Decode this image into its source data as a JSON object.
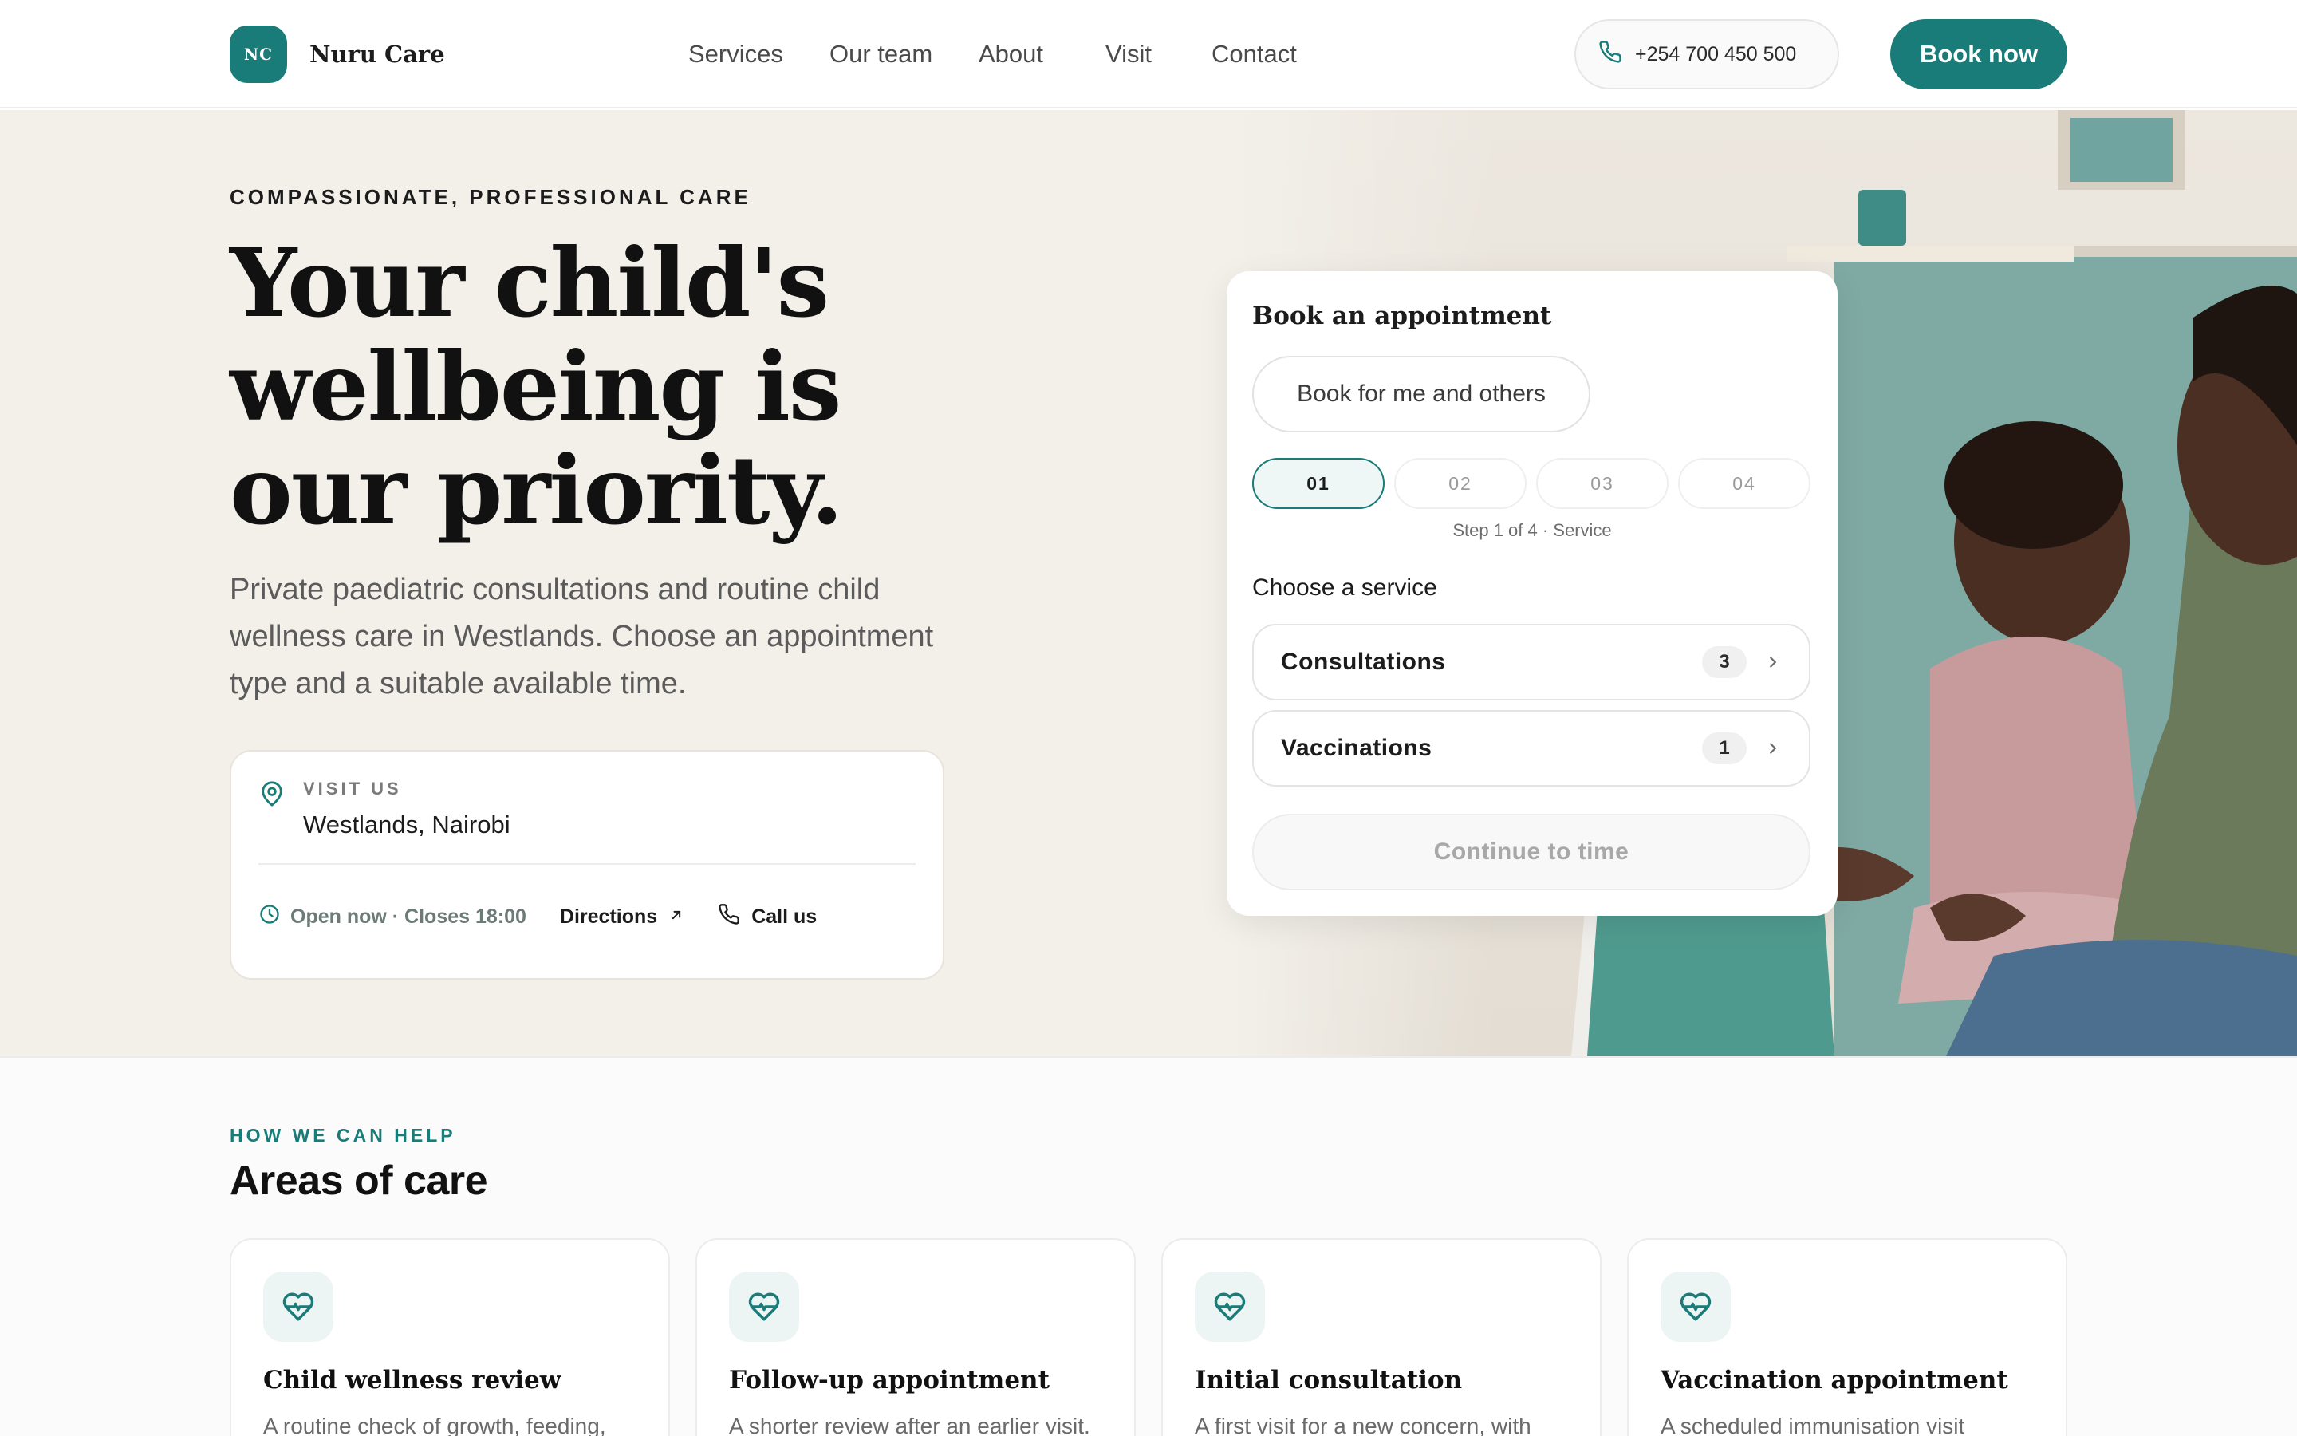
{
  "brand": {
    "monogram": "NC",
    "name": "Nuru Care"
  },
  "nav": {
    "items": [
      "Services",
      "Our team",
      "About",
      "Visit",
      "Contact"
    ],
    "phone": "+254 700 450 500",
    "book_label": "Book now"
  },
  "hero": {
    "eyebrow": "COMPASSIONATE, PROFESSIONAL CARE",
    "headline_lines": [
      "Your child's",
      "wellbeing is",
      "our priority."
    ],
    "lead": "Private paediatric consultations and routine child wellness care in Westlands. Choose an appointment type and a suitable available time.",
    "visit": {
      "label": "VISIT US",
      "location": "Westlands, Nairobi",
      "status": "Open now · Closes 18:00",
      "directions": "Directions",
      "call": "Call us"
    }
  },
  "booking": {
    "title": "Book an appointment",
    "for_option": "Book for me and others",
    "steps": [
      "01",
      "02",
      "03",
      "04"
    ],
    "active_step": 0,
    "step_caption": "Step 1 of 4 · Service",
    "choose_label": "Choose a service",
    "services": [
      {
        "name": "Consultations",
        "count": "3"
      },
      {
        "name": "Vaccinations",
        "count": "1"
      }
    ],
    "continue_label": "Continue to time"
  },
  "areas": {
    "eyebrow": "HOW WE CAN HELP",
    "title": "Areas of care",
    "cards": [
      {
        "icon": "heart-pulse-icon",
        "title": "Child wellness review",
        "desc": "A routine check of growth, feeding,"
      },
      {
        "icon": "heart-pulse-icon",
        "title": "Follow-up appointment",
        "desc": "A shorter review after an earlier visit."
      },
      {
        "icon": "heart-pulse-icon",
        "title": "Initial consultation",
        "desc": "A first visit for a new concern, with"
      },
      {
        "icon": "heart-pulse-icon",
        "title": "Vaccination appointment",
        "desc": "A scheduled immunisation visit"
      }
    ]
  },
  "colors": {
    "brand": "#1a7c78",
    "hero_bg": "#f3f0ea",
    "text": "#1c1c1c"
  }
}
